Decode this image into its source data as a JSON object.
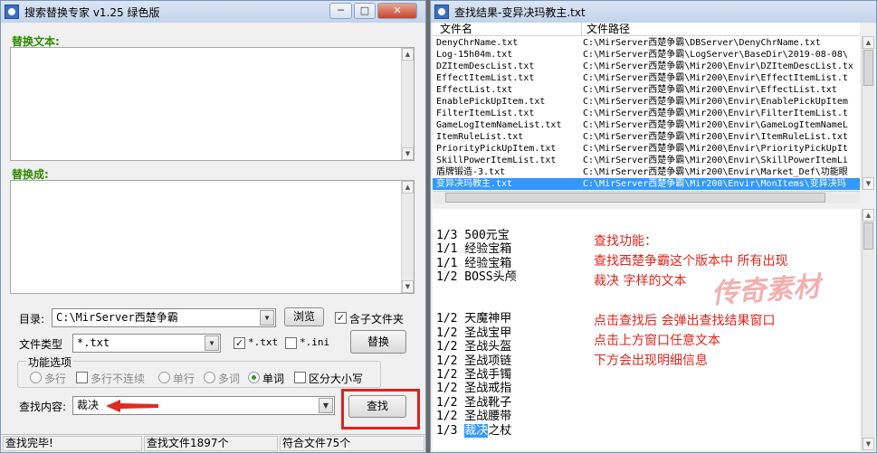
{
  "left_window": {
    "title": "搜索替换专家 v1.25  绿色版",
    "replace_text_label": "替换文本:",
    "replace_with_label": "替换成:",
    "dir_label": "目录:",
    "dir_value": "C:\\MirServer西楚争霸",
    "browse_button": "浏览",
    "include_subdirs_label": "含子文件夹",
    "filetype_label": "文件类型",
    "filetype_value": "*.txt",
    "ext_txt_label": "*.txt",
    "ext_ini_label": "*.ini",
    "replace_button": "替换",
    "options_title": "功能选项",
    "options": [
      {
        "label": "多行",
        "kind": "radio",
        "checked": false
      },
      {
        "label": "多行不连续",
        "kind": "check",
        "checked": false
      },
      {
        "label": "单行",
        "kind": "radio",
        "checked": false
      },
      {
        "label": "多词",
        "kind": "radio",
        "checked": false
      },
      {
        "label": "单词",
        "kind": "radio",
        "checked": true
      },
      {
        "label": "区分大小写",
        "kind": "check",
        "checked": false
      }
    ],
    "search_label": "查找内容:",
    "search_value": "裁决",
    "find_button": "查找",
    "status": [
      "查找完毕!",
      "查找文件1897个",
      "符合文件75个"
    ]
  },
  "right_window": {
    "title": "查找结果-变异决玛教主.txt",
    "col_filename": "文件名",
    "col_filepath": "文件路径",
    "rows": [
      {
        "name": "DenyChrName.txt",
        "path": "C:\\MirServer西楚争霸\\DBServer\\DenyChrName.txt",
        "selected": false
      },
      {
        "name": "Log-15h04m.txt",
        "path": "C:\\MirServer西楚争霸\\LogServer\\BaseDir\\2019-08-08\\",
        "selected": false
      },
      {
        "name": "DZItemDescList.txt",
        "path": "C:\\MirServer西楚争霸\\Mir200\\Envir\\DZItemDescList.tx",
        "selected": false
      },
      {
        "name": "EffectItemList.txt",
        "path": "C:\\MirServer西楚争霸\\Mir200\\Envir\\EffectItemList.t",
        "selected": false
      },
      {
        "name": "EffectList.txt",
        "path": "C:\\MirServer西楚争霸\\Mir200\\Envir\\EffectList.txt",
        "selected": false
      },
      {
        "name": "EnablePickUpItem.txt",
        "path": "C:\\MirServer西楚争霸\\Mir200\\Envir\\EnablePickUpItem",
        "selected": false
      },
      {
        "name": "FilterItemList.txt",
        "path": "C:\\MirServer西楚争霸\\Mir200\\Envir\\FilterItemList.t",
        "selected": false
      },
      {
        "name": "GameLogItemNameList.txt",
        "path": "C:\\MirServer西楚争霸\\Mir200\\Envir\\GameLogItemNameL",
        "selected": false
      },
      {
        "name": "ItemRuleList.txt",
        "path": "C:\\MirServer西楚争霸\\Mir200\\Envir\\ItemRuleList.txt",
        "selected": false
      },
      {
        "name": "PriorityPickUpItem.txt",
        "path": "C:\\MirServer西楚争霸\\Mir200\\Envir\\PriorityPickUpIt",
        "selected": false
      },
      {
        "name": "SkillPowerItemList.txt",
        "path": "C:\\MirServer西楚争霸\\Mir200\\Envir\\SkillPowerItemLi",
        "selected": false
      },
      {
        "name": "盾牌锻造-3.txt",
        "path": "C:\\MirServer西楚争霸\\Mir200\\Envir\\Market_Def\\功能眼",
        "selected": false
      },
      {
        "name": "变异决玛教主.txt",
        "path": "C:\\MirServer西楚争霸\\Mir200\\Envir\\MonItems\\变异决玛",
        "selected": true
      }
    ],
    "details": [
      {
        "pre": "1/3 500元宝",
        "hl": "",
        "post": ""
      },
      {
        "pre": "1/1 经验宝箱",
        "hl": "",
        "post": ""
      },
      {
        "pre": "1/1 经验宝箱",
        "hl": "",
        "post": ""
      },
      {
        "pre": "1/2 BOSS头颅",
        "hl": "",
        "post": ""
      },
      {
        "pre": "",
        "hl": "",
        "post": ""
      },
      {
        "pre": "",
        "hl": "",
        "post": ""
      },
      {
        "pre": "1/2 天魔神甲",
        "hl": "",
        "post": ""
      },
      {
        "pre": "1/2 圣战宝甲",
        "hl": "",
        "post": ""
      },
      {
        "pre": "1/2 圣战头盔",
        "hl": "",
        "post": ""
      },
      {
        "pre": "1/2 圣战项链",
        "hl": "",
        "post": ""
      },
      {
        "pre": "1/2 圣战手镯",
        "hl": "",
        "post": ""
      },
      {
        "pre": "1/2 圣战戒指",
        "hl": "",
        "post": ""
      },
      {
        "pre": "1/2 圣战靴子",
        "hl": "",
        "post": ""
      },
      {
        "pre": "1/2 圣战腰带",
        "hl": "",
        "post": ""
      },
      {
        "pre": "1/3 ",
        "hl": "裁决",
        "post": "之杖"
      }
    ],
    "notes": [
      "查找功能：",
      "查找西楚争霸这个版本中 所有出现",
      "裁决 字样的文本",
      "",
      "点击查找后 会弹出查找结果窗口",
      "点击上方窗口任意文本",
      "下方会出现明细信息"
    ]
  },
  "colors": {
    "accent_green": "#2e8b00",
    "annotation_red": "#e0261c",
    "selection_blue": "#3399ff"
  }
}
